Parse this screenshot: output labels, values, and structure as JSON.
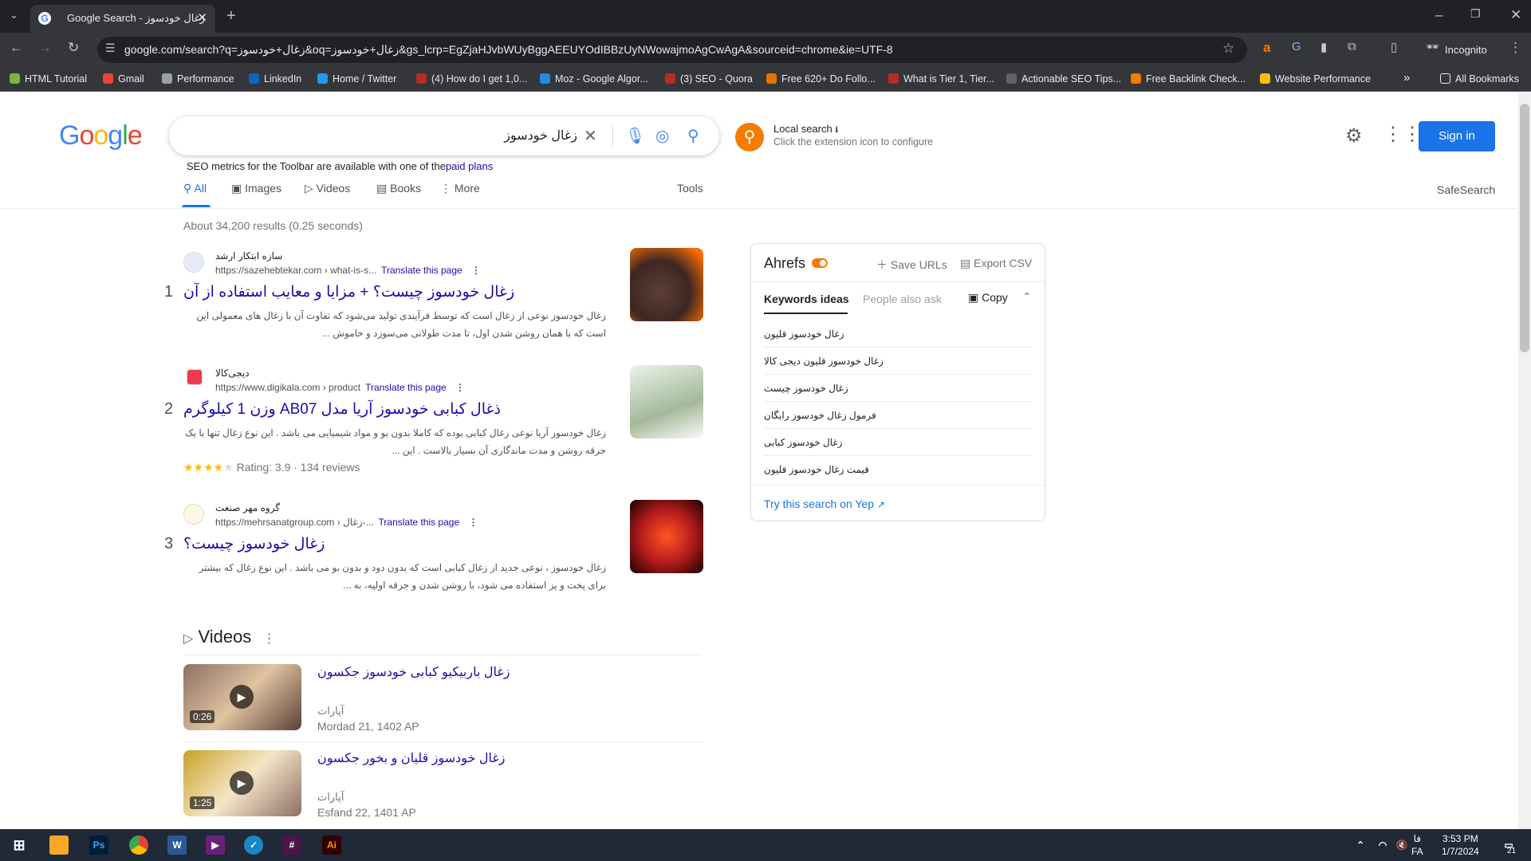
{
  "browser": {
    "tab_title": "Google Search - زغال خودسوز",
    "url": "google.com/search?q=زغال+خودسوز&oq=زغال+خودسوز&gs_lcrp=EgZjaHJvbWUyBggAEEUYOdIBBzUyNWowajmoAgCwAgA&sourceid=chrome&ie=UTF-8",
    "incognito_label": "Incognito",
    "bookmarks": [
      "HTML Tutorial",
      "Gmail",
      "Performance",
      "LinkedIn",
      "Home / Twitter",
      "(4) How do I get 1,0...",
      "Moz - Google Algor...",
      "(3) SEO - Quora",
      "Free 620+ Do Follo...",
      "What is Tier 1, Tier...",
      "Actionable SEO Tips...",
      "Free Backlink Check...",
      "Website Performance"
    ],
    "all_bookmarks": "All Bookmarks",
    "bookmark_more": "»"
  },
  "google": {
    "logo": "Google",
    "query": "زغال خودسوز",
    "ext_title": "Local search",
    "ext_info": "ℹ",
    "ext_sub": "Click the extension icon to configure",
    "seo_text": "SEO metrics for the Toolbar are available with one of the",
    "seo_link": "paid plans",
    "tabs": [
      "All",
      "Images",
      "Videos",
      "Books",
      "More"
    ],
    "tools": "Tools",
    "safesearch": "SafeSearch",
    "signin": "Sign in",
    "stats": "About 34,200 results (0.25 seconds)"
  },
  "results": [
    {
      "num": "1",
      "site": "سازه ابتکار ارشد",
      "url": "https://sazehebtekar.com › what-is-s...",
      "translate": "Translate this page",
      "title": "زغال خودسوز چیست؟ + مزایا و معایب استفاده از آن",
      "snippet": "زغال خودسوز نوعی از زغال است که توسط فرآیندی تولید می‌شود که تفاوت آن با زغال های معمولی این است که با همان روشن شدن اول، تا مدت طولانی می‌سوزد و خاموش ..."
    },
    {
      "num": "2",
      "site": "دیجی‌کالا",
      "url": "https://www.digikala.com › product",
      "translate": "Translate this page",
      "title": "ذغال کبابی خودسوز آریا مدل AB07 وزن 1 کیلوگرم",
      "snippet": "زغال خودسوز آریا نوعی زغال کبابی بوده که کاملا بدون بو و مواد شیمیایی می باشد . این نوع زغال تنها با یک جرقه روشن و مدت ماندگاری آن بسیار بالاست . این ...",
      "stars": "★★★★",
      "star_empty": "★",
      "rating": "Rating: 3.9 · 134 reviews"
    },
    {
      "num": "3",
      "site": "گروه مهر صنعت",
      "url": "https://mehrsanatgroup.com › زغال-...",
      "translate": "Translate this page",
      "title": "زغال خودسوز چیست؟",
      "snippet": "زغال خودسوز ، نوعی جدید از زغال کبابی است که بدون دود و بدون بو می باشد . این نوع زغال که بیشتر برای پخت و پز استفاده می شود، با روشن شدن و جرقه اولیه، به ..."
    }
  ],
  "videos": {
    "heading": "Videos",
    "items": [
      {
        "title": "زغال باربیکیو کبابی خودسوز جکسون",
        "source": "آپارات",
        "date": "Mordad 21, 1402 AP",
        "duration": "0:26"
      },
      {
        "title": "زغال خودسوز قلیان و بخور جکسون",
        "source": "آپارات",
        "date": "Esfand 22, 1401 AP",
        "duration": "1:25"
      }
    ]
  },
  "ahrefs": {
    "title": "Ahrefs",
    "save_urls": "Save URLs",
    "export_csv": "Export CSV",
    "tab_keywords": "Keywords ideas",
    "tab_people": "People also ask",
    "copy": "Copy",
    "keywords": [
      "زغال خودسوز قلیون",
      "زغال خودسوز قلیون دیجی کالا",
      "زغال خودسوز چیست",
      "فرمول زغال خودسوز رایگان",
      "زغال خودسوز کبابی",
      "قیمت زغال خودسوز قلیون"
    ],
    "yep": "Try this search on Yep"
  },
  "taskbar": {
    "time": "3:53 PM",
    "date": "1/7/2024",
    "lang_top": "فا",
    "lang_bottom": "FA",
    "notif": "21"
  },
  "colors": {
    "brand_blue": "#1a73e8",
    "link": "#1a0dab",
    "ahrefs_orange": "#f57c00"
  }
}
